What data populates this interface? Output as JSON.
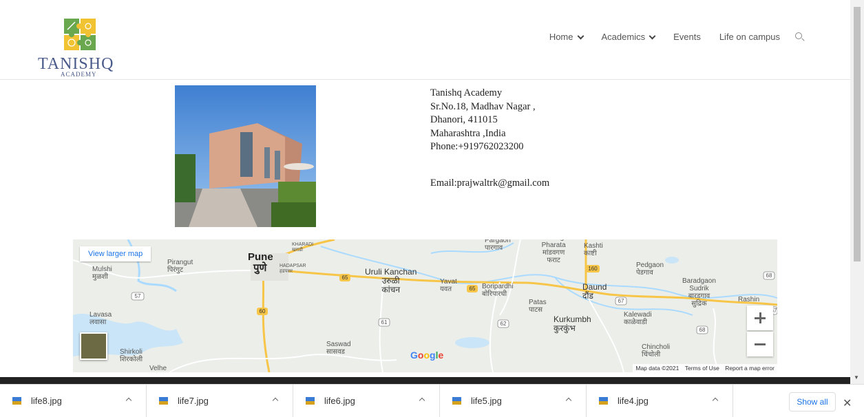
{
  "logo": {
    "name": "TANISHQ",
    "sub": "ACADEMY"
  },
  "nav": {
    "items": [
      {
        "label": "Home",
        "dropdown": true
      },
      {
        "label": "Academics",
        "dropdown": true
      },
      {
        "label": "Events",
        "dropdown": false
      },
      {
        "label": "Life on campus",
        "dropdown": false
      }
    ]
  },
  "contact": {
    "lines": [
      "Tanishq Academy",
      "Sr.No.18, Madhav Nagar ,",
      "Dhanori, 411015",
      "Maharashtra ,India",
      "Phone:+919762023200"
    ],
    "email": "Email:prajwaltrk@gmail.com"
  },
  "map": {
    "view_larger": "View larger map",
    "labels": {
      "mulshi": "Mulshi\nमुळशी",
      "pirangut": "Pirangut\nपिरंगुट",
      "pune_en": "Pune",
      "pune_mr": "पुणे",
      "kharadi": "KHARADI\nखराडी",
      "hadapsar": "HADAPSAR\nहडपसर",
      "uruli": "Uruli Kanchan\nउरुळी\nकांचन",
      "yavat": "Yavat\nयवत",
      "boripardhi": "Boripardhi\nबोरिपारधी",
      "pargaon": "Pargaon\nपारगाव",
      "pharata": "Mandavgan\nPharata\nमांडवगण\nफराट",
      "kashti": "Kashti\nकाष्टी",
      "pedgaon": "Pedgaon\nपेडगाव",
      "baradgaon": "Baradgaon\nSudrik\nबारडगाव\nसुद्रिक",
      "rashin": "Rashin",
      "daund": "Daund\nदौंड",
      "patas": "Patas\nपाटस",
      "kurkumbh": "Kurkumbh\nकुरकुंभ",
      "kalewadi": "Kalewadi\nकाळेवाडी",
      "chincholi": "Chincholi\nचिंचोली",
      "lavasa": "Lavasa\nलवासा",
      "shirkoli": "Shirkoli\nशिरकोली",
      "saswad": "Saswad\nसासवड",
      "velhe": "Velhe"
    },
    "shields": [
      "57",
      "65",
      "65",
      "60",
      "61",
      "62",
      "67",
      "68",
      "160",
      "68",
      "67"
    ],
    "google": "Google",
    "attribution": [
      "Map data ©2021",
      "Terms of Use",
      "Report a map error"
    ]
  },
  "downloads": {
    "files": [
      "life8.jpg",
      "life7.jpg",
      "life6.jpg",
      "life5.jpg",
      "life4.jpg"
    ],
    "show_all": "Show all",
    "close": "✕"
  },
  "colors": {
    "accent": "#1a73e8",
    "logo": "#4a5a8a",
    "map_bg": "#eceee9",
    "water": "#aadaff",
    "highway": "#f7c548"
  }
}
